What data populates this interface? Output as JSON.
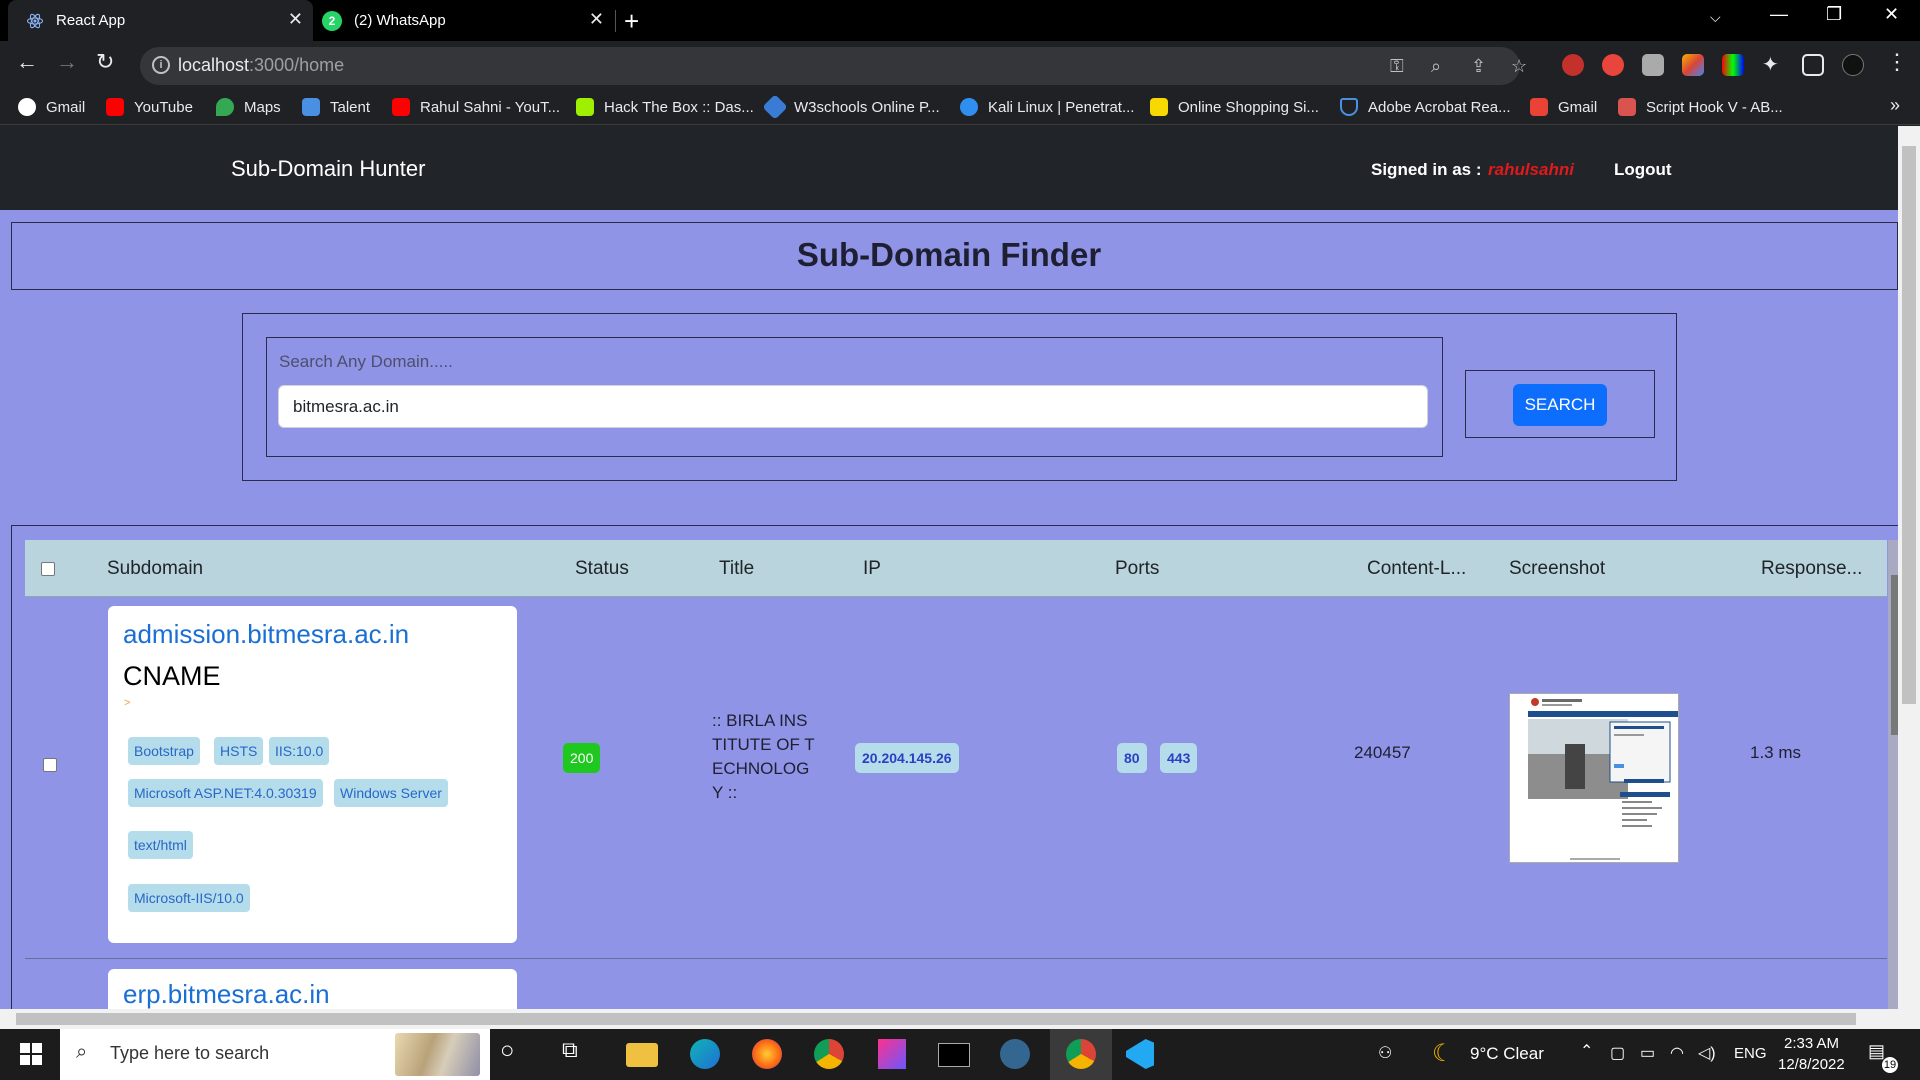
{
  "browser": {
    "tabs": [
      {
        "title": "React App",
        "active": true
      },
      {
        "title": "(2) WhatsApp",
        "active": false,
        "badge": "2"
      }
    ],
    "address": {
      "host": "localhost",
      "rest": ":3000/home"
    },
    "bookmarks": [
      {
        "label": "Gmail",
        "icon": "google-icon",
        "color": "#ffffff"
      },
      {
        "label": "YouTube",
        "icon": "youtube-icon",
        "color": "#ff0000"
      },
      {
        "label": "Maps",
        "icon": "maps-icon",
        "color": "#34a853"
      },
      {
        "label": "Talent",
        "icon": "talent-icon",
        "color": "#4a90e2"
      },
      {
        "label": "Rahul Sahni - YouT...",
        "icon": "youtube-icon",
        "color": "#ff0000"
      },
      {
        "label": "Hack The Box :: Das...",
        "icon": "hackthebox-icon",
        "color": "#9fef00"
      },
      {
        "label": "W3schools Online P...",
        "icon": "w3schools-icon",
        "color": "#3a7bd5"
      },
      {
        "label": "Kali Linux | Penetrat...",
        "icon": "kali-icon",
        "color": "#2f8ef0"
      },
      {
        "label": "Online Shopping Si...",
        "icon": "flipkart-icon",
        "color": "#f7d900"
      },
      {
        "label": "Adobe Acrobat Rea...",
        "icon": "shield-icon",
        "color": "#4a90e2"
      },
      {
        "label": "Gmail",
        "icon": "gmail-icon",
        "color": "#ea4335"
      },
      {
        "label": "Script Hook V - AB...",
        "icon": "script-hook-icon",
        "color": "#d9534f"
      }
    ]
  },
  "navbar": {
    "brand": "Sub-Domain Hunter",
    "signed_in_label": "Signed in as :",
    "username": "rahulsahni",
    "logout": "Logout"
  },
  "page": {
    "title": "Sub-Domain Finder",
    "search": {
      "label": "Search Any Domain.....",
      "value": "bitmesra.ac.in",
      "button": "SEARCH"
    }
  },
  "table": {
    "columns": [
      "Subdomain",
      "Status",
      "Title",
      "IP",
      "Ports",
      "Content-L...",
      "Screenshot",
      "Response..."
    ],
    "rows": [
      {
        "subdomain": "admission.bitmesra.ac.in",
        "record": "CNAME",
        "arrow": ">",
        "tags": [
          "Bootstrap",
          "HSTS",
          "IIS:10.0",
          "Microsoft ASP.NET:4.0.30319",
          "Windows Server",
          "text/html",
          "Microsoft-IIS/10.0"
        ],
        "status": "200",
        "title": ":: BIRLA INSTITUTE OF TECHNOLOGY ::",
        "ip": "20.204.145.26",
        "ports": [
          "80",
          "443"
        ],
        "content_length": "240457",
        "response": "1.3 ms"
      },
      {
        "subdomain": "erp.bitmesra.ac.in"
      }
    ]
  },
  "taskbar": {
    "search_placeholder": "Type here to search",
    "weather": "9°C  Clear",
    "lang": "ENG",
    "time": "2:33 AM",
    "date": "12/8/2022",
    "notifications": "19"
  }
}
